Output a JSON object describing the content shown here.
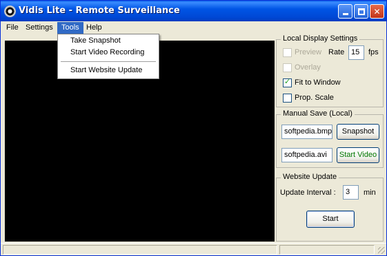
{
  "window": {
    "title": "Vidis Lite - Remote Surveillance"
  },
  "menubar": {
    "items": [
      "File",
      "Settings",
      "Tools",
      "Help"
    ]
  },
  "tools_menu": {
    "items": [
      "Take Snapshot",
      "Start Video Recording",
      "Start Website Update"
    ]
  },
  "local_display": {
    "legend": "Local Display Settings",
    "preview_label": "Preview",
    "rate_label": "Rate",
    "rate_value": "15",
    "fps_label": "fps",
    "overlay_label": "Overlay",
    "fit_label": "Fit to Window",
    "prop_label": "Prop. Scale",
    "preview_checked": false,
    "overlay_checked": false,
    "fit_checked": true,
    "prop_checked": false
  },
  "manual_save": {
    "legend": "Manual Save (Local)",
    "snapshot_file": "softpedia.bmp",
    "snapshot_button": "Snapshot",
    "video_file": "softpedia.avi",
    "video_button": "Start Video"
  },
  "website_update": {
    "legend": "Website Update",
    "interval_label": "Update Interval :",
    "interval_value": "3",
    "interval_unit": "min",
    "start_button": "Start"
  },
  "colors": {
    "title_bar": "#0054E3",
    "menu_highlight": "#316AC5",
    "video_background": "#000000",
    "video_button_text": "#007700"
  }
}
